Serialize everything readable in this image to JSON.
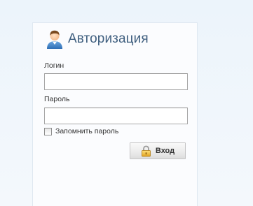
{
  "auth": {
    "title": "Авторизация",
    "login_label": "Логин",
    "login_value": "",
    "password_label": "Пароль",
    "password_value": "",
    "remember_label": "Запомнить пароль",
    "remember_checked": false,
    "submit_label": "Вход"
  },
  "icons": {
    "header": "user-icon",
    "submit": "lock-icon"
  },
  "colors": {
    "title": "#3f5f7f",
    "background": "#ecf4fb",
    "panel": "#fbfcfe"
  }
}
